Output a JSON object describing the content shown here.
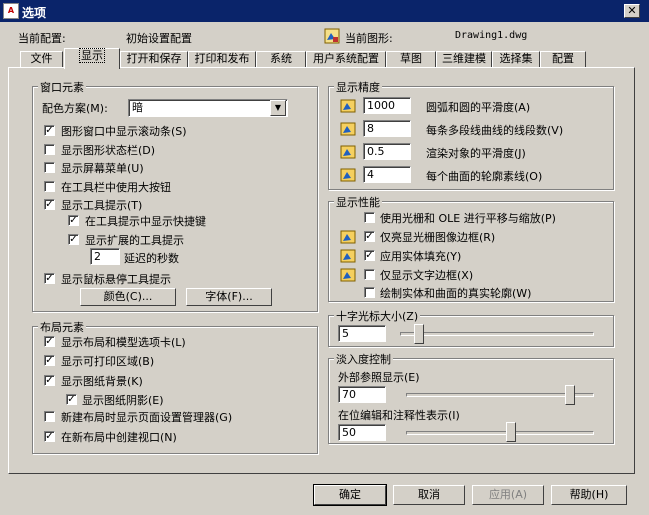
{
  "window": {
    "title": "选项",
    "close": "✕"
  },
  "header": {
    "current_profile_label": "当前配置:",
    "current_profile_value": "初始设置配置",
    "current_drawing_label": "当前图形:",
    "current_drawing_value": "Drawing1.dwg"
  },
  "tabs": [
    "文件",
    "显示",
    "打开和保存",
    "打印和发布",
    "系统",
    "用户系统配置",
    "草图",
    "三维建模",
    "选择集",
    "配置"
  ],
  "window_elements": {
    "title": "窗口元素",
    "color_scheme_label": "配色方案(M):",
    "color_scheme_value": "暗",
    "checkboxes": [
      {
        "label": "图形窗口中显示滚动条(S)",
        "checked": true
      },
      {
        "label": "显示图形状态栏(D)",
        "checked": false
      },
      {
        "label": "显示屏幕菜单(U)",
        "checked": false
      },
      {
        "label": "在工具栏中使用大按钮",
        "checked": false
      },
      {
        "label": "显示工具提示(T)",
        "checked": true
      },
      {
        "label": "在工具提示中显示快捷键",
        "checked": true
      },
      {
        "label": "显示扩展的工具提示",
        "checked": true
      },
      {
        "label": "显示鼠标悬停工具提示",
        "checked": true
      }
    ],
    "delay_value": "2",
    "delay_label": "延迟的秒数",
    "colors_button": "颜色(C)...",
    "fonts_button": "字体(F)..."
  },
  "layout_elements": {
    "title": "布局元素",
    "checkboxes": [
      {
        "label": "显示布局和模型选项卡(L)",
        "checked": true
      },
      {
        "label": "显示可打印区域(B)",
        "checked": true
      },
      {
        "label": "显示图纸背景(K)",
        "checked": true
      },
      {
        "label": "显示图纸阴影(E)",
        "checked": true
      },
      {
        "label": "新建布局时显示页面设置管理器(G)",
        "checked": false
      },
      {
        "label": "在新布局中创建视口(N)",
        "checked": true
      }
    ]
  },
  "display_resolution": {
    "title": "显示精度",
    "items": [
      {
        "value": "1000",
        "label": "圆弧和圆的平滑度(A)"
      },
      {
        "value": "8",
        "label": "每条多段线曲线的线段数(V)"
      },
      {
        "value": "0.5",
        "label": "渲染对象的平滑度(J)"
      },
      {
        "value": "4",
        "label": "每个曲面的轮廓素线(O)"
      }
    ]
  },
  "display_performance": {
    "title": "显示性能",
    "checkboxes": [
      {
        "label": "使用光栅和 OLE 进行平移与缩放(P)",
        "checked": false
      },
      {
        "label": "仅亮显光栅图像边框(R)",
        "checked": true
      },
      {
        "label": "应用实体填充(Y)",
        "checked": true
      },
      {
        "label": "仅显示文字边框(X)",
        "checked": false
      },
      {
        "label": "绘制实体和曲面的真实轮廓(W)",
        "checked": false
      }
    ]
  },
  "crosshair": {
    "title": "十字光标大小(Z)",
    "value": "5",
    "level": 5
  },
  "fade_control": {
    "title": "淡入度控制",
    "xref_label": "外部参照显示(E)",
    "xref_value": "70",
    "xref_level": 70,
    "inplace_label": "在位编辑和注释性表示(I)",
    "inplace_value": "50",
    "inplace_level": 50
  },
  "buttons": {
    "ok": "确定",
    "cancel": "取消",
    "apply": "应用(A)",
    "help": "帮助(H)"
  },
  "icons": {
    "drawing": "drawing-file-icon",
    "saved_in_drawing": "drawing-saved-setting-icon"
  }
}
